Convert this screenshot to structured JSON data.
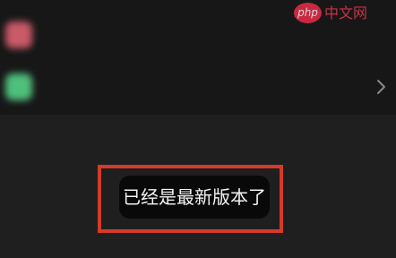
{
  "settings_list": {
    "rows": [
      {
        "label": "",
        "icon": "red-app-icon",
        "icon_color": "#c95a68"
      },
      {
        "label": "",
        "icon": "green-app-icon",
        "icon_color": "#4fbf7c",
        "trailing_icon": "chevron-right-icon"
      }
    ]
  },
  "toast": {
    "message": "已经是最新版本了"
  },
  "watermark": {
    "logo_text": "php",
    "site_text": "中文网"
  },
  "colors": {
    "background": "#1f1f1f",
    "panel": "#171717",
    "toast_background": "#090909",
    "highlight_border": "#d53a2b",
    "watermark_accent": "#ef2d4a"
  }
}
